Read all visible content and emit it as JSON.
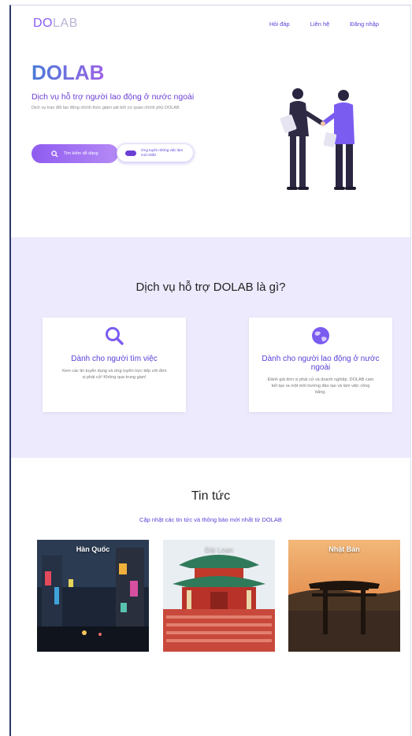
{
  "header": {
    "logo_part1": "DO",
    "logo_part2": "LAB",
    "nav": [
      "Hỏi đáp",
      "Liên hệ",
      "Đăng nhập"
    ]
  },
  "hero": {
    "title": "DOLAB",
    "subtitle": "Dịch vụ hỗ trợ người lao động ở nước ngoài",
    "description": "Dịch vụ trao đổi lao động chính thức giám sát bởi cơ quan chính phủ DOLAB",
    "primary_button": "Tìm kiếm dễ dàng",
    "secondary_button": "Ứng tuyển những việc làm mới nhất!"
  },
  "services": {
    "title": "Dịch vụ hỗ trợ DOLAB là gì?",
    "cards": [
      {
        "icon": "search-icon",
        "title": "Dành cho người tìm việc",
        "text": "Xem các tin tuyển dụng và ứng tuyển trực tiếp với đơn vị phái cử! Không qua trung gian!"
      },
      {
        "icon": "globe-icon",
        "title": "Dành cho người lao động ở nước ngoài",
        "text": "Đánh giá đơn vị phái cử và doanh nghiệp. DOLAB cam kết tạo ra một môi trường đào tạo và làm việc công bằng."
      }
    ]
  },
  "news": {
    "title": "Tin tức",
    "subtitle": "Cập nhật các tin tức và thông báo mới nhất từ DOLAB",
    "items": [
      {
        "label": "Hàn Quốc"
      },
      {
        "label": "Đài Loan"
      },
      {
        "label": "Nhật Bản"
      }
    ]
  },
  "colors": {
    "accent": "#6b3fd4",
    "services_bg": "#eeeafe"
  }
}
